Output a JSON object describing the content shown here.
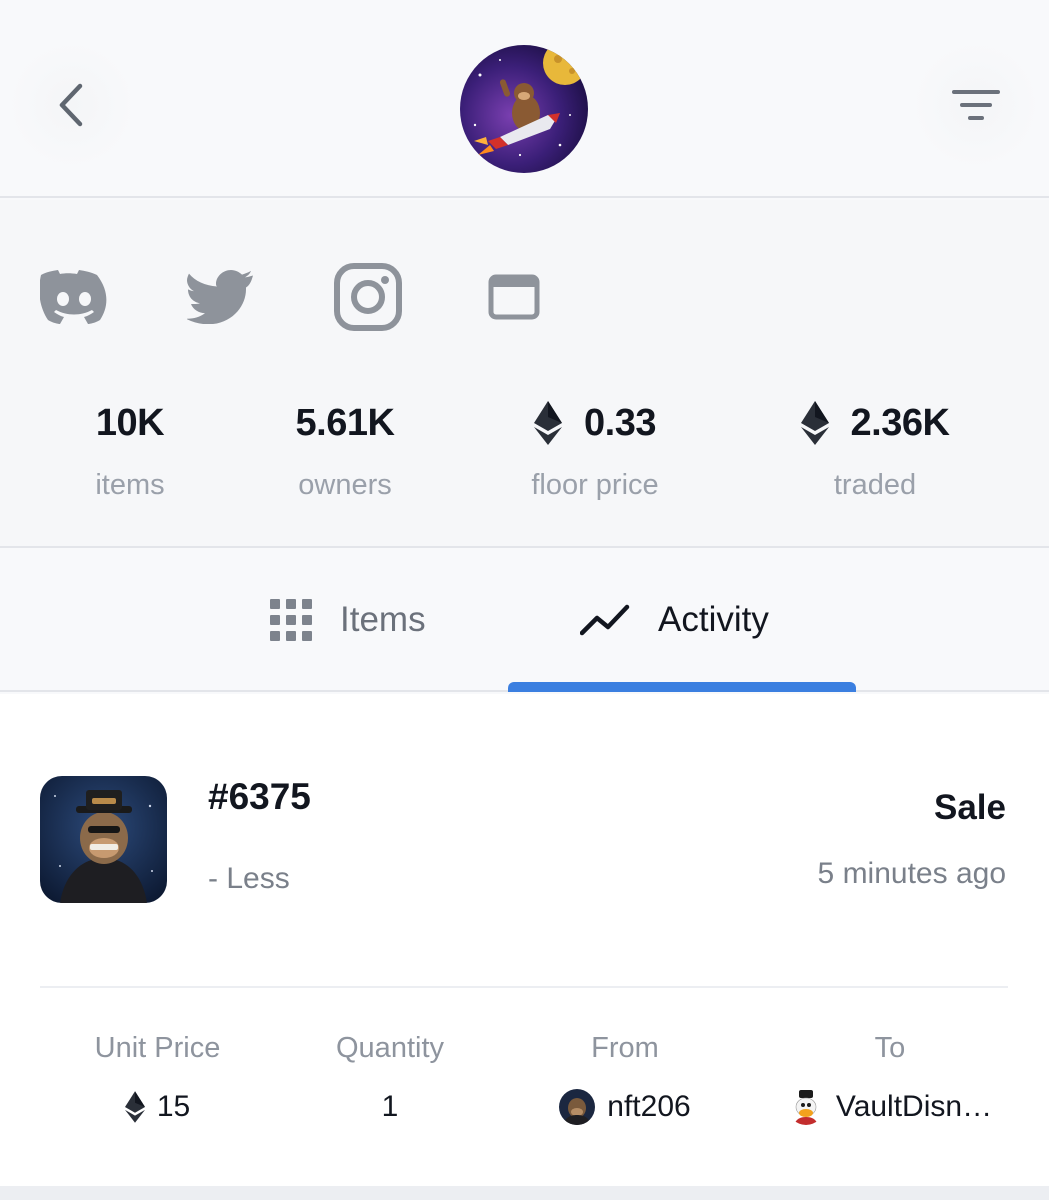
{
  "header": {
    "back_icon": "chevron-left-icon",
    "filter_icon": "filter-icon",
    "avatar_alt": "collection-avatar"
  },
  "socials": [
    "discord-icon",
    "twitter-icon",
    "instagram-icon",
    "website-icon"
  ],
  "stats": [
    {
      "value": "10K",
      "label": "items",
      "eth": false
    },
    {
      "value": "5.61K",
      "label": "owners",
      "eth": false
    },
    {
      "value": "0.33",
      "label": "floor price",
      "eth": true
    },
    {
      "value": "2.36K",
      "label": "traded",
      "eth": true
    }
  ],
  "tabs": {
    "items": "Items",
    "activity": "Activity",
    "active": "activity"
  },
  "activity": {
    "nft_id": "#6375",
    "less": "- Less",
    "event_type": "Sale",
    "time": "5 minutes ago",
    "columns": {
      "unit_price": {
        "head": "Unit Price",
        "value": "15"
      },
      "quantity": {
        "head": "Quantity",
        "value": "1"
      },
      "from": {
        "head": "From",
        "value": "nft206"
      },
      "to": {
        "head": "To",
        "value": "VaultDisn…"
      }
    }
  },
  "colors": {
    "accent": "#3b7fe0",
    "icon_gray": "#8e939b",
    "text_dark": "#12161f",
    "text_muted": "#9aa0aa"
  }
}
